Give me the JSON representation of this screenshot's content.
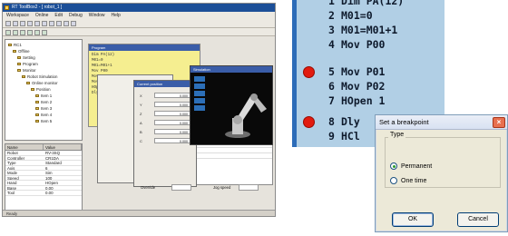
{
  "ide": {
    "title": "RT ToolBox2 - [ robot_1 ]",
    "menu": [
      "Workspace",
      "Online",
      "Edit",
      "Debug",
      "Window",
      "Help"
    ],
    "tree": [
      "RC1",
      "Offline",
      "Setting",
      "Program",
      "Monitor",
      "Robot Simulation",
      "Online monitor",
      "Position",
      "Item 1",
      "Item 2",
      "Item 3",
      "Item 4",
      "Item 5"
    ],
    "props_headers": [
      "Name",
      "Value"
    ],
    "props_rows": [
      [
        "Robot",
        "RV-3SQ"
      ],
      [
        "Controller",
        "CR1DA"
      ],
      [
        "Type",
        "Standard"
      ],
      [
        "Axis",
        "6"
      ],
      [
        "Mode",
        "Sim"
      ],
      [
        "Speed",
        "100"
      ],
      [
        "Hand",
        "HOpen"
      ],
      [
        "Base",
        "0.00"
      ],
      [
        "Tool",
        "0.00"
      ]
    ],
    "code_lines": [
      "Dim PA(12)",
      "M01=0",
      "M01=M01+1",
      "Mov P00",
      "Mov P01",
      "Mov P02",
      "HOpen 1",
      "Dly 0.5"
    ],
    "monitor_title": "Current position",
    "monitor_labels": [
      "X",
      "Y",
      "Z",
      "A",
      "B",
      "C"
    ],
    "monitor_values": [
      "0.000",
      "0.000",
      "0.000",
      "0.000",
      "0.000",
      "0.000"
    ],
    "sim_title": "Simulation",
    "field1_label": "Override",
    "field2_label": "Jog speed",
    "status": "Ready"
  },
  "program": {
    "lines": [
      {
        "num": "1",
        "text": "Dim PA(12)",
        "breakpoint": false
      },
      {
        "num": "2",
        "text": "M01=0",
        "breakpoint": false
      },
      {
        "num": "3",
        "text": "M01=M01+1",
        "breakpoint": false
      },
      {
        "num": "4",
        "text": "Mov P00",
        "breakpoint": false
      },
      {
        "num": "5",
        "text": "Mov P01",
        "breakpoint": true
      },
      {
        "num": "6",
        "text": "Mov P02",
        "breakpoint": false
      },
      {
        "num": "7",
        "text": "HOpen 1",
        "breakpoint": false
      },
      {
        "num": "8",
        "text": "Dly",
        "breakpoint": true
      },
      {
        "num": "9",
        "text": "HCl",
        "breakpoint": false
      }
    ]
  },
  "dialog": {
    "title": "Set a breakpoint",
    "group_label": "Type",
    "options": [
      {
        "label": "Permanent",
        "selected": true
      },
      {
        "label": "One time",
        "selected": false
      }
    ],
    "ok_label": "OK",
    "cancel_label": "Cancel",
    "colors": {
      "close_button": "#e8704f",
      "breakpoint": "#e21b0f",
      "code_bg": "#b1cfe5"
    }
  }
}
